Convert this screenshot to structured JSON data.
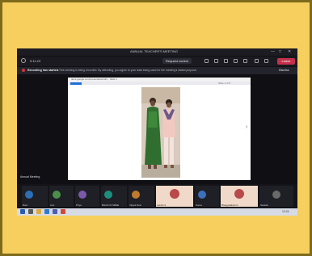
{
  "window": {
    "title": "ANNUAL TEACHER'S MEETING",
    "controls": [
      "—",
      "□",
      "✕"
    ]
  },
  "toolbar": {
    "elapsed_time": "0:11:23",
    "popout_label": "Request control",
    "leave_label": "Leave"
  },
  "recording": {
    "strong_text": "Recording has started.",
    "notice_text": "This meeting is being recorded. By attending, you agree to your data being used for the meeting's stated purpose.",
    "dismiss_label": "Dismiss"
  },
  "shared_content": {
    "url_text": "docs.google.com/presentation/d/1 · Slide 1",
    "right_text": "Slide 1 of 8"
  },
  "presenter": {
    "name": "Annual Meeting"
  },
  "participants": [
    {
      "name": "Ravi",
      "color": "#2d6fb5"
    },
    {
      "name": "Anu",
      "color": "#4a8f4a"
    },
    {
      "name": "Priya",
      "color": "#7a5aa8"
    },
    {
      "name": "BHAGYA SREE",
      "color": "#1c8f7c"
    },
    {
      "name": "Vijaya Devi",
      "color": "#c07b2a"
    },
    {
      "name": "Lakshmi",
      "color": "#b84a4a"
    },
    {
      "name": "Suma",
      "color": "#3d6fbb"
    },
    {
      "name": "Bhagyalakshmi",
      "color": "#b84a4a"
    },
    {
      "name": "Sarada",
      "color": "#6a6a6a"
    }
  ],
  "taskbar": {
    "time": "10:24"
  }
}
